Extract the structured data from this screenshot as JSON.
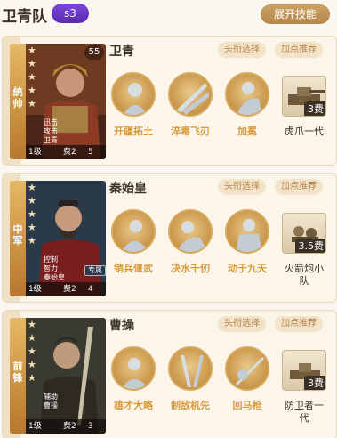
{
  "header": {
    "team_title": "卫青队",
    "season_badge": "s3",
    "expand_button": "展开技能"
  },
  "pills": {
    "head": "头衔选择",
    "rec": "加点推荐"
  },
  "cards": [
    {
      "role": "统帅",
      "name": "卫青",
      "tags": [
        "迅击",
        "攻击",
        "卫青"
      ],
      "level": "1级",
      "cost": "费2",
      "extra": "5",
      "corner": "55",
      "skills": [
        "开疆拓土",
        "淬毒飞刃",
        "加冕"
      ],
      "gear": {
        "name": "虎爪一代",
        "cost": "3费"
      }
    },
    {
      "role": "中军",
      "name": "秦始皇",
      "tags": [
        "控制",
        "智力",
        "秦始皇"
      ],
      "level": "1级",
      "cost": "费2",
      "extra": "4",
      "corner_tag": "专属",
      "skills": [
        "销兵偃武",
        "决水千仞",
        "动于九天"
      ],
      "gear": {
        "name": "火箭炮小队",
        "cost": "3.5费"
      }
    },
    {
      "role": "前锋",
      "name": "曹操",
      "tags": [
        "辅助",
        "曹操"
      ],
      "level": "1级",
      "cost": "费2",
      "extra": "3",
      "skills": [
        "雄才大略",
        "制敌机先",
        "回马枪"
      ],
      "gear": {
        "name": "防卫者一代",
        "cost": "3费"
      }
    }
  ],
  "colors": {
    "accent": "#d89b3d",
    "badge": "#6a36c6",
    "button": "#c09356"
  }
}
